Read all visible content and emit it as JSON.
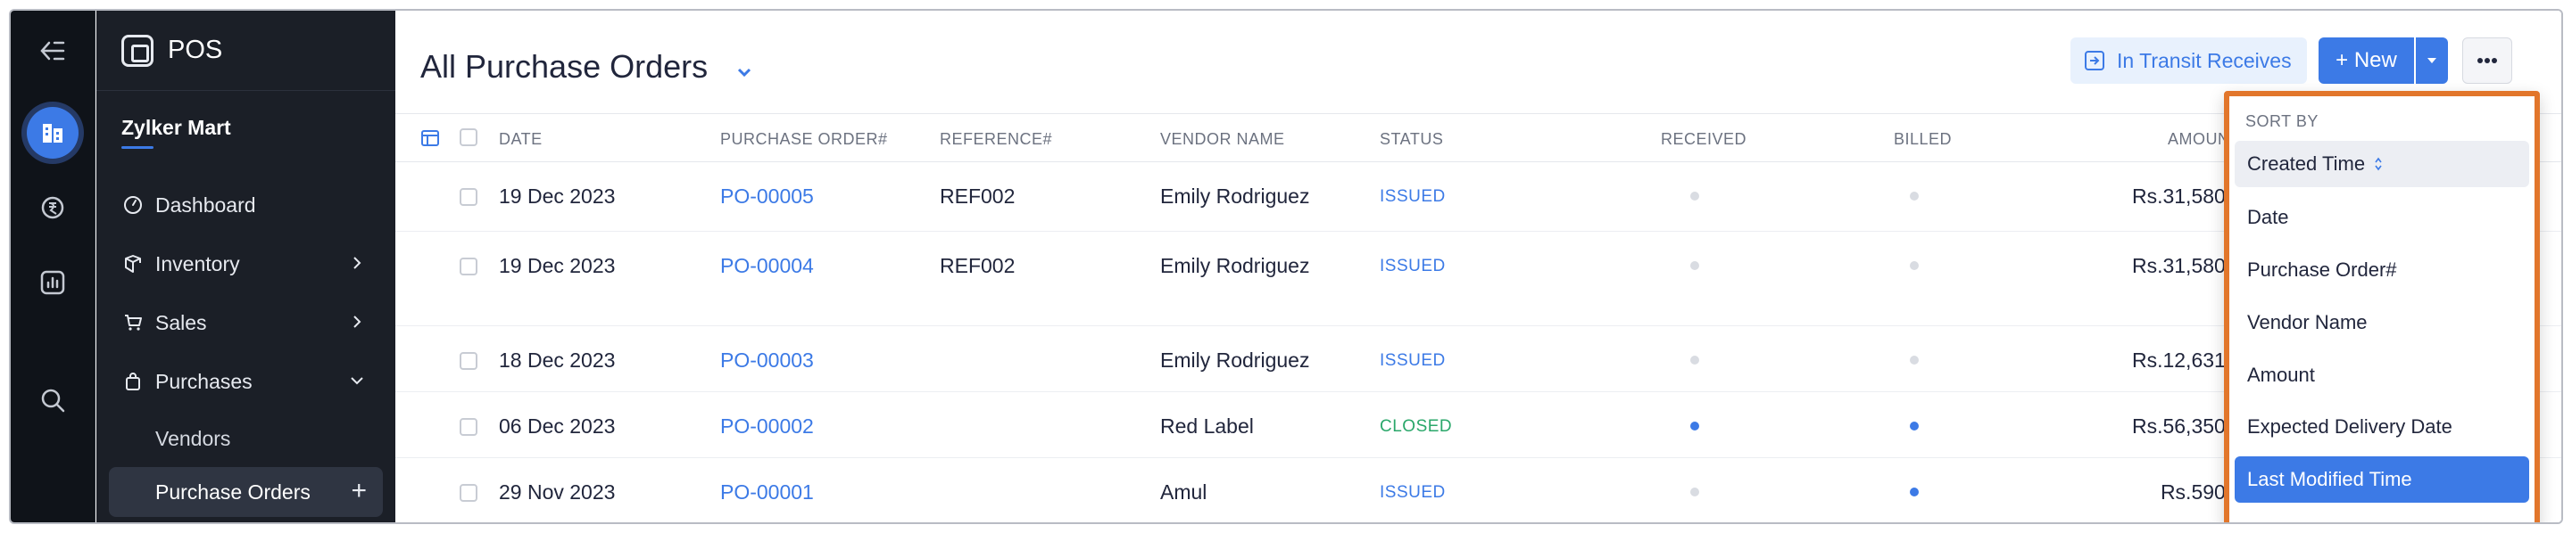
{
  "app": {
    "name": "POS",
    "company": "Zylker Mart"
  },
  "sidebar": {
    "items": [
      {
        "label": "Dashboard",
        "icon": "dashboard-icon"
      },
      {
        "label": "Inventory",
        "icon": "inventory-icon"
      },
      {
        "label": "Sales",
        "icon": "cart-icon"
      },
      {
        "label": "Purchases",
        "icon": "bag-icon"
      },
      {
        "label": "Vendors"
      },
      {
        "label": "Purchase Orders"
      }
    ]
  },
  "header": {
    "title": "All Purchase Orders",
    "transit_label": "In Transit Receives",
    "new_label": "+ New"
  },
  "table": {
    "columns": [
      "DATE",
      "PURCHASE ORDER#",
      "REFERENCE#",
      "VENDOR NAME",
      "STATUS",
      "RECEIVED",
      "BILLED",
      "AMOUNT"
    ],
    "rows": [
      {
        "date": "19 Dec 2023",
        "po": "PO-00005",
        "ref": "REF002",
        "vendor": "Emily Rodriguez",
        "status": "ISSUED",
        "received": 0,
        "billed": 0,
        "amount": "Rs.31,580.2"
      },
      {
        "date": "19 Dec 2023",
        "po": "PO-00004",
        "ref": "REF002",
        "vendor": "Emily Rodriguez",
        "status": "ISSUED",
        "received": 0,
        "billed": 0,
        "amount": "Rs.31,580.2"
      },
      {
        "date": "18 Dec 2023",
        "po": "PO-00003",
        "ref": "",
        "vendor": "Emily Rodriguez",
        "status": "ISSUED",
        "received": 0,
        "billed": 0,
        "amount": "Rs.12,631.0"
      },
      {
        "date": "06 Dec 2023",
        "po": "PO-00002",
        "ref": "",
        "vendor": "Red Label",
        "status": "CLOSED",
        "received": 1,
        "billed": 1,
        "amount": "Rs.56,350.0"
      },
      {
        "date": "29 Nov 2023",
        "po": "PO-00001",
        "ref": "",
        "vendor": "Amul",
        "status": "ISSUED",
        "received": 0,
        "billed": 1,
        "amount": "Rs.590.0"
      }
    ]
  },
  "sort_menu": {
    "heading": "SORT BY",
    "options": [
      "Created Time",
      "Date",
      "Purchase Order#",
      "Vendor Name",
      "Amount",
      "Expected Delivery Date",
      "Last Modified Time"
    ],
    "selected": "Created Time",
    "highlighted": "Last Modified Time"
  },
  "colors": {
    "accent": "#3c7ae6",
    "closed": "#2aa76a",
    "highlight_border": "#e2762b",
    "sidebar_bg": "#1b1f27",
    "rail_bg": "#0f1319"
  }
}
